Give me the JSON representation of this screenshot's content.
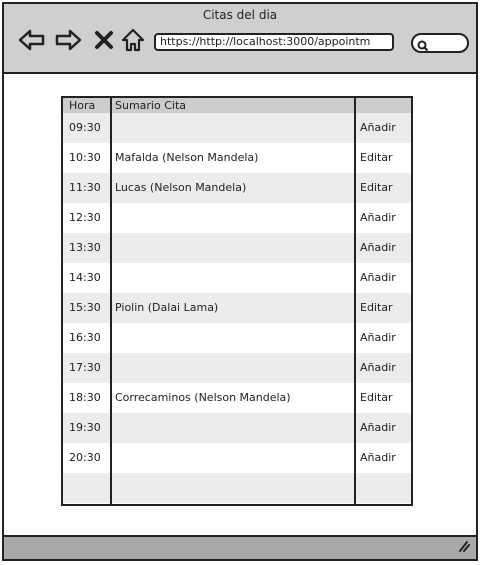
{
  "window": {
    "title": "Citas del dia",
    "url": "https://http://localhost:3000/appointm"
  },
  "nav": {
    "back_icon": "arrow-left-icon",
    "forward_icon": "arrow-right-icon",
    "stop_icon": "close-icon",
    "home_icon": "home-icon",
    "search_icon": "search-icon"
  },
  "table": {
    "headers": [
      "Hora",
      "Sumario Cita",
      ""
    ],
    "rows": [
      {
        "time": "09:30",
        "summary": "",
        "action": "Añadir"
      },
      {
        "time": "10:30",
        "summary": "Mafalda (Nelson Mandela)",
        "action": "Editar"
      },
      {
        "time": "11:30",
        "summary": "Lucas (Nelson Mandela)",
        "action": "Editar"
      },
      {
        "time": "12:30",
        "summary": "",
        "action": "Añadir"
      },
      {
        "time": "13:30",
        "summary": "",
        "action": "Añadir"
      },
      {
        "time": "14:30",
        "summary": "",
        "action": "Añadir"
      },
      {
        "time": "15:30",
        "summary": "Piolin (Dalai Lama)",
        "action": "Editar"
      },
      {
        "time": "16:30",
        "summary": "",
        "action": "Añadir"
      },
      {
        "time": "17:30",
        "summary": "",
        "action": "Añadir"
      },
      {
        "time": "18:30",
        "summary": "Correcaminos (Nelson Mandela)",
        "action": "Editar"
      },
      {
        "time": "19:30",
        "summary": "",
        "action": "Añadir"
      },
      {
        "time": "20:30",
        "summary": "",
        "action": "Añadir"
      },
      {
        "time": "",
        "summary": "",
        "action": ""
      }
    ]
  },
  "colors": {
    "titlebar": "#cfcfcf",
    "statusbar": "#a9a9a9",
    "header": "#cccccc",
    "row_shade": "#ececec",
    "border": "#222222"
  }
}
